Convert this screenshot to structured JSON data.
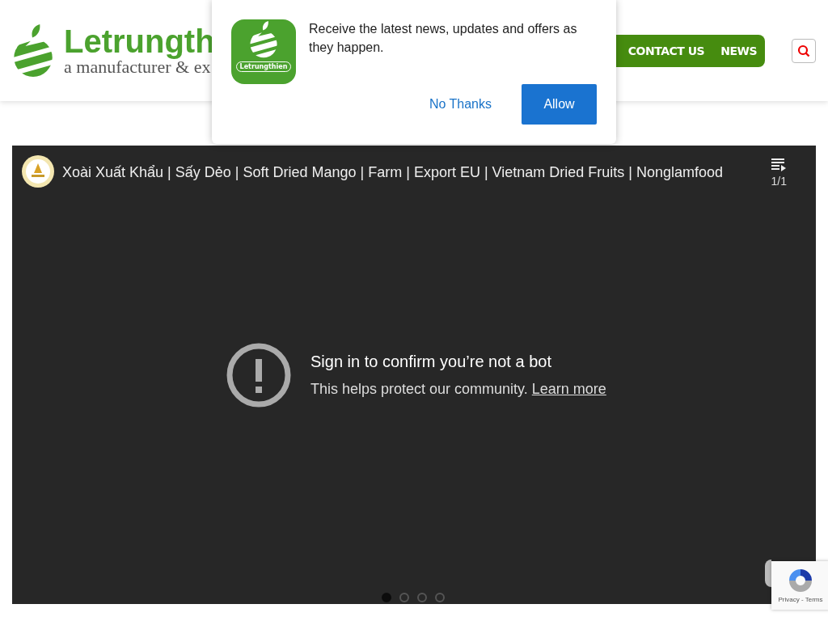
{
  "header": {
    "logo": {
      "name": "Letrungth",
      "tagline": "a manufacturer & ex"
    },
    "nav": [
      {
        "label": "CONTACT US"
      },
      {
        "label": "NEWS"
      }
    ]
  },
  "notification": {
    "app_name": "Letrungthien",
    "message": "Receive the latest news, updates and offers as they happen.",
    "buttons": [
      {
        "label": "No Thanks",
        "kind": "link"
      },
      {
        "label": "Allow",
        "kind": "primary"
      }
    ]
  },
  "video": {
    "title": "Xoài Xuất Khẩu | Sấy Dẻo | Soft Dried Mango | Farm | Export EU | Vietnam Dried Fruits | Nonglamfood",
    "playlist_count": "1/1",
    "error": {
      "heading": "Sign in to confirm you’re not a bot",
      "message": "This helps protect our community.",
      "link": "Learn more"
    }
  },
  "carousel": {
    "dots": [
      {
        "selected": true
      },
      {
        "selected": false
      },
      {
        "selected": false
      },
      {
        "selected": false
      }
    ]
  },
  "recaptcha": {
    "links": "Privacy - Terms"
  }
}
